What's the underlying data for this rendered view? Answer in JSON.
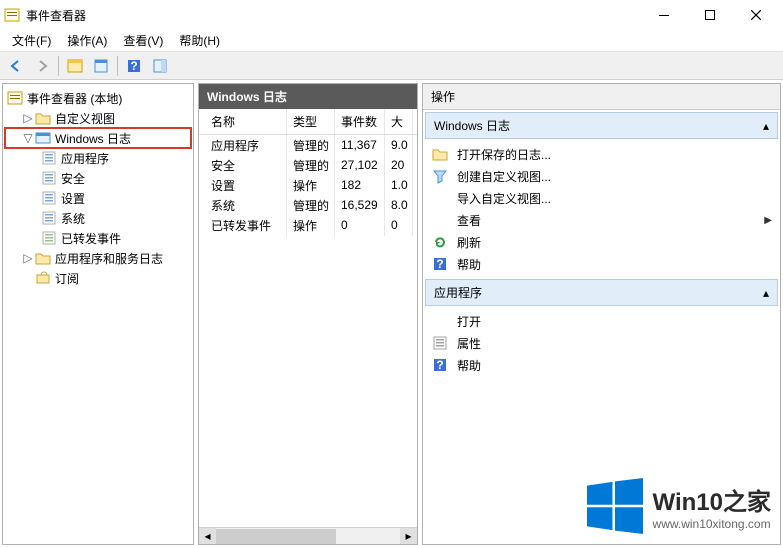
{
  "window": {
    "title": "事件查看器"
  },
  "menu": {
    "file": "文件(F)",
    "action": "操作(A)",
    "view": "查看(V)",
    "help": "帮助(H)"
  },
  "tree": {
    "root": "事件查看器 (本地)",
    "custom_views": "自定义视图",
    "windows_logs": "Windows 日志",
    "application": "应用程序",
    "security": "安全",
    "setup": "设置",
    "system": "系统",
    "forwarded": "已转发事件",
    "app_service_logs": "应用程序和服务日志",
    "subscriptions": "订阅"
  },
  "center": {
    "title": "Windows 日志",
    "columns": {
      "c0": "名称",
      "c1": "类型",
      "c2": "事件数",
      "c3": "大"
    },
    "rows": [
      {
        "name": "应用程序",
        "type": "管理的",
        "count": "11,367",
        "size": "9.0"
      },
      {
        "name": "安全",
        "type": "管理的",
        "count": "27,102",
        "size": "20"
      },
      {
        "name": "设置",
        "type": "操作",
        "count": "182",
        "size": "1.0"
      },
      {
        "name": "系统",
        "type": "管理的",
        "count": "16,529",
        "size": "8.0"
      },
      {
        "name": "已转发事件",
        "type": "操作",
        "count": "0",
        "size": "0"
      }
    ]
  },
  "actions": {
    "header": "操作",
    "section1": {
      "title": "Windows 日志",
      "items": {
        "open_saved": "打开保存的日志...",
        "create_custom": "创建自定义视图...",
        "import_custom": "导入自定义视图...",
        "view": "查看",
        "refresh": "刷新",
        "help": "帮助"
      }
    },
    "section2": {
      "title": "应用程序",
      "items": {
        "open": "打开",
        "properties": "属性",
        "help": "帮助"
      }
    }
  },
  "watermark": {
    "title": "Win10之家",
    "url": "www.win10xitong.com"
  }
}
